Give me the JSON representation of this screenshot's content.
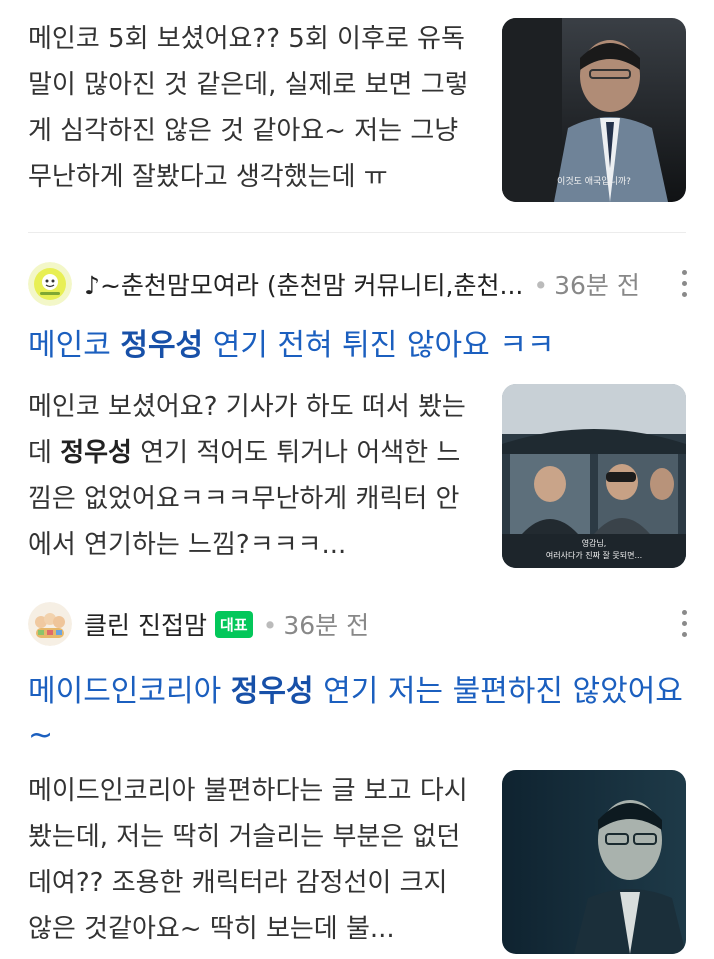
{
  "post0": {
    "snippet": "메인코 5회 보셨어요?? 5회 이후로 유독 말이 많아진 것 같은데, 실제로 보면 그렇게 심각하진 않은 것 같아요~ 저는 그냥 무난하게 잘봤다고 생각했는데 ㅠ",
    "thumb_caption": "이것도 애국입니까?"
  },
  "post1": {
    "cafe_name": "♪~춘천맘모여라 (춘천맘 커뮤니티,춘천...",
    "time": "36분 전",
    "title_pre": "메인코 ",
    "title_highlight": "정우성",
    "title_post": " 연기 전혀 튀진 않아요 ㅋㅋ",
    "snippet_pre": "메인코 보셨어요? 기사가 하도 떠서 봤는데 ",
    "snippet_highlight": "정우성",
    "snippet_post": " 연기 적어도 튀거나 어색한 느낌은 없었어요ㅋㅋㅋ무난하게 캐릭터 안에서 연기하는 느낌?ㅋㅋㅋ...",
    "thumb_caption_1": "영감님,",
    "thumb_caption_2": "여러사다가 진짜 잘 못되면..."
  },
  "post2": {
    "cafe_name": "클린 진접맘",
    "badge": "대표",
    "time": "36분 전",
    "title_pre": "메이드인코리아 ",
    "title_highlight": "정우성",
    "title_post": " 연기 저는 불편하진 않았어요~",
    "snippet": "메이드인코리아 불편하다는 글 보고 다시 봤는데, 저는 딱히 거슬리는 부분은 없던데여?? 조용한 캐릭터라 감정선이 크지 않은 것같아요~ 딱히 보는데 불..."
  },
  "colors": {
    "title_blue": "#1b5fbf",
    "badge_green": "#03c75a",
    "meta_gray": "#888888"
  },
  "icons": [
    "more-vertical-icon",
    "cafe-avatar"
  ]
}
